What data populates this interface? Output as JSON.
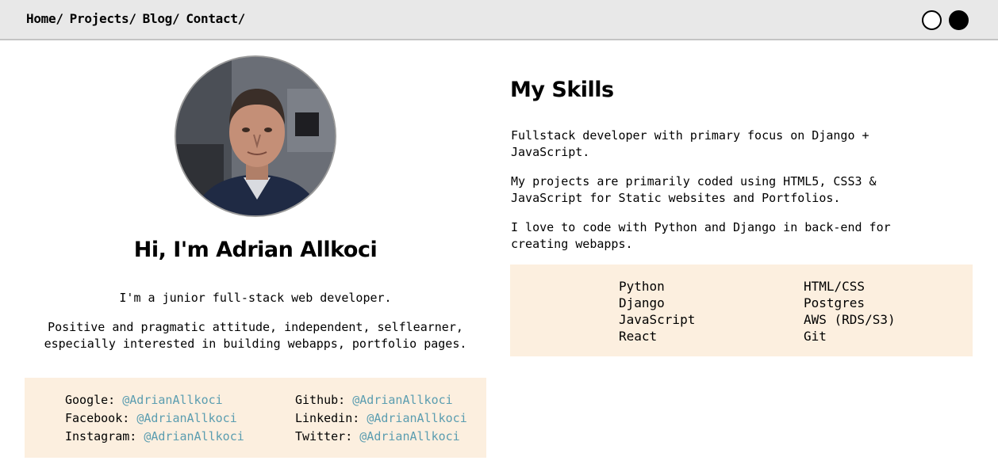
{
  "nav": {
    "links": [
      "Home/",
      "Projects/",
      "Blog/",
      "Contact/"
    ]
  },
  "theme": {
    "light_color": "#ffffff",
    "dark_color": "#000000"
  },
  "hero": {
    "name": "Hi, I'm Adrian Allkoci",
    "tagline": "I'm a junior full-stack web developer.",
    "bio": "Positive and pragmatic attitude, independent, selflearner, especially interested in building webapps, portfolio pages."
  },
  "social": {
    "left": [
      {
        "label": "Google:",
        "handle": "@AdrianAllkoci"
      },
      {
        "label": "Facebook:",
        "handle": "@AdrianAllkoci"
      },
      {
        "label": "Instagram:",
        "handle": "@AdrianAllkoci"
      }
    ],
    "right": [
      {
        "label": "Github:",
        "handle": "@AdrianAllkoci"
      },
      {
        "label": "Linkedin:",
        "handle": "@AdrianAllkoci"
      },
      {
        "label": "Twitter:",
        "handle": "@AdrianAllkoci"
      }
    ]
  },
  "skills": {
    "title": "My Skills",
    "paragraphs": [
      "Fullstack developer with primary focus on Django + JavaScript.",
      "My projects are primarily coded using HTML5, CSS3 & JavaScript for Static websites and Portfolios.",
      "I love to code with Python and Django in back-end for creating webapps."
    ],
    "left": [
      "Python",
      "Django",
      "JavaScript",
      "React"
    ],
    "right": [
      "HTML/CSS",
      "Postgres",
      "AWS (RDS/S3)",
      "Git"
    ]
  },
  "colors": {
    "accent_box": "#fcefdf",
    "link": "#5b9db0",
    "navbar": "#e8e8e8"
  }
}
